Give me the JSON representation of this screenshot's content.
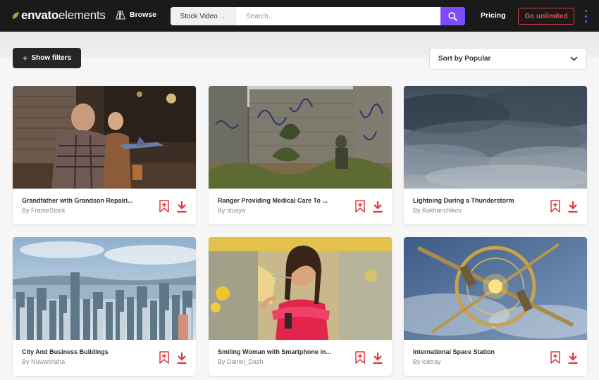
{
  "header": {
    "logo_bold": "envato",
    "logo_light": "elements",
    "browse_label": "Browse",
    "search_category": "Stock Video",
    "search_placeholder": "Search...",
    "pricing_label": "Pricing",
    "cta_label": "Go unlimited"
  },
  "toolbar": {
    "filters_label": "Show filters",
    "sort_label": "Sort by Popular"
  },
  "colors": {
    "accent": "#7b4dff",
    "brand_red": "#e0383f",
    "header_bg": "#1a1a1a",
    "logo_green": "#82b541"
  },
  "cards": [
    {
      "title": "Grandfather with Grandson Repairi...",
      "by": "By",
      "author": "FrameStock"
    },
    {
      "title": "Ranger Providing Medical Care To ...",
      "by": "By",
      "author": "stusya"
    },
    {
      "title": "Lightning During a Thunderstorm",
      "by": "By",
      "author": "Kokhanchikov"
    },
    {
      "title": "City And Business Buildings",
      "by": "By",
      "author": "Nuwanhaha"
    },
    {
      "title": "Smiling Woman with Smartphone in...",
      "by": "By",
      "author": "Daniel_Dash"
    },
    {
      "title": "International Space Station",
      "by": "By",
      "author": "icetray"
    }
  ]
}
